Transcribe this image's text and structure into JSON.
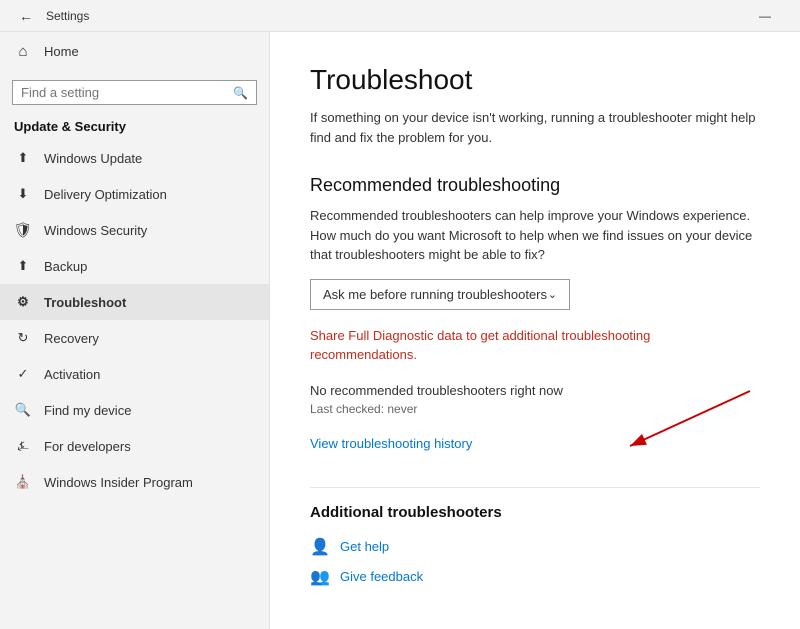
{
  "titlebar": {
    "title": "Settings",
    "minimize_label": "—"
  },
  "sidebar": {
    "search_placeholder": "Find a setting",
    "home_label": "Home",
    "section_title": "Update & Security",
    "items": [
      {
        "id": "windows-update",
        "label": "Windows Update",
        "icon": "↑"
      },
      {
        "id": "delivery-optimization",
        "label": "Delivery Optimization",
        "icon": "⬇"
      },
      {
        "id": "windows-security",
        "label": "Windows Security",
        "icon": "🛡"
      },
      {
        "id": "backup",
        "label": "Backup",
        "icon": "↑"
      },
      {
        "id": "troubleshoot",
        "label": "Troubleshoot",
        "icon": "👤"
      },
      {
        "id": "recovery",
        "label": "Recovery",
        "icon": "↺"
      },
      {
        "id": "activation",
        "label": "Activation",
        "icon": "✓"
      },
      {
        "id": "find-my-device",
        "label": "Find my device",
        "icon": "📍"
      },
      {
        "id": "for-developers",
        "label": "For developers",
        "icon": "⌨"
      },
      {
        "id": "windows-insider",
        "label": "Windows Insider Program",
        "icon": "🏠"
      }
    ]
  },
  "content": {
    "page_title": "Troubleshoot",
    "page_desc": "If something on your device isn't working, running a troubleshooter might help find and fix the problem for you.",
    "recommended_section_title": "Recommended troubleshooting",
    "recommended_desc": "Recommended troubleshooters can help improve your Windows experience. How much do you want Microsoft to help when we find issues on your device that troubleshooters might be able to fix?",
    "dropdown_label": "Ask me before running troubleshooters",
    "diagnostic_link": "Share Full Diagnostic data to get additional troubleshooting recommendations.",
    "status_text": "No recommended troubleshooters right now",
    "last_checked": "Last checked: never",
    "history_link": "View troubleshooting history",
    "additional_section_title": "Additional troubleshooters",
    "get_help_label": "Get help",
    "give_feedback_label": "Give feedback"
  }
}
